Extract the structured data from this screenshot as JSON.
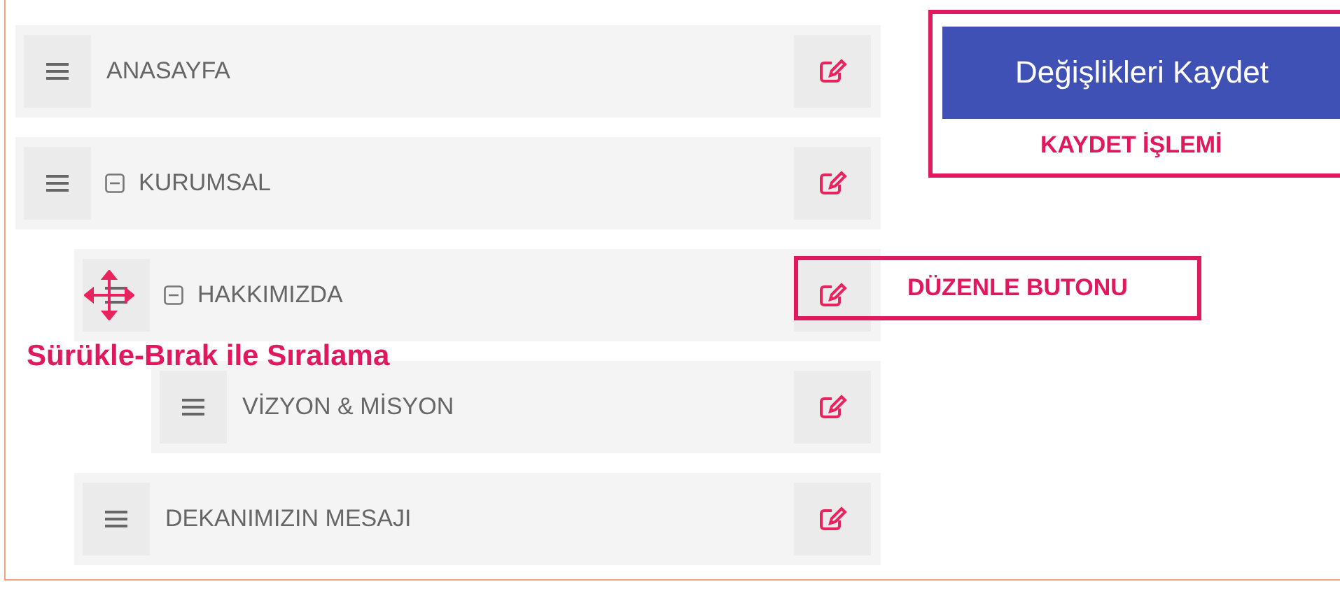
{
  "menu": [
    {
      "label": "ANASAYFA",
      "dragging": false
    },
    {
      "label": "KURUMSAL",
      "dragging": false,
      "expanded": true,
      "children": [
        {
          "label": "HAKKIMIZDA",
          "dragging": true,
          "expanded": true,
          "children": [
            {
              "label": "VİZYON & MİSYON",
              "dragging": false
            }
          ]
        },
        {
          "label": "DEKANIMIZIN MESAJI",
          "dragging": false
        }
      ]
    }
  ],
  "save_button": {
    "label": "Değişlikleri Kaydet"
  },
  "callouts": {
    "save": "KAYDET İŞLEMİ",
    "edit": "DÜZENLE BUTONU",
    "drag": "Sürükle-Bırak ile Sıralama"
  }
}
